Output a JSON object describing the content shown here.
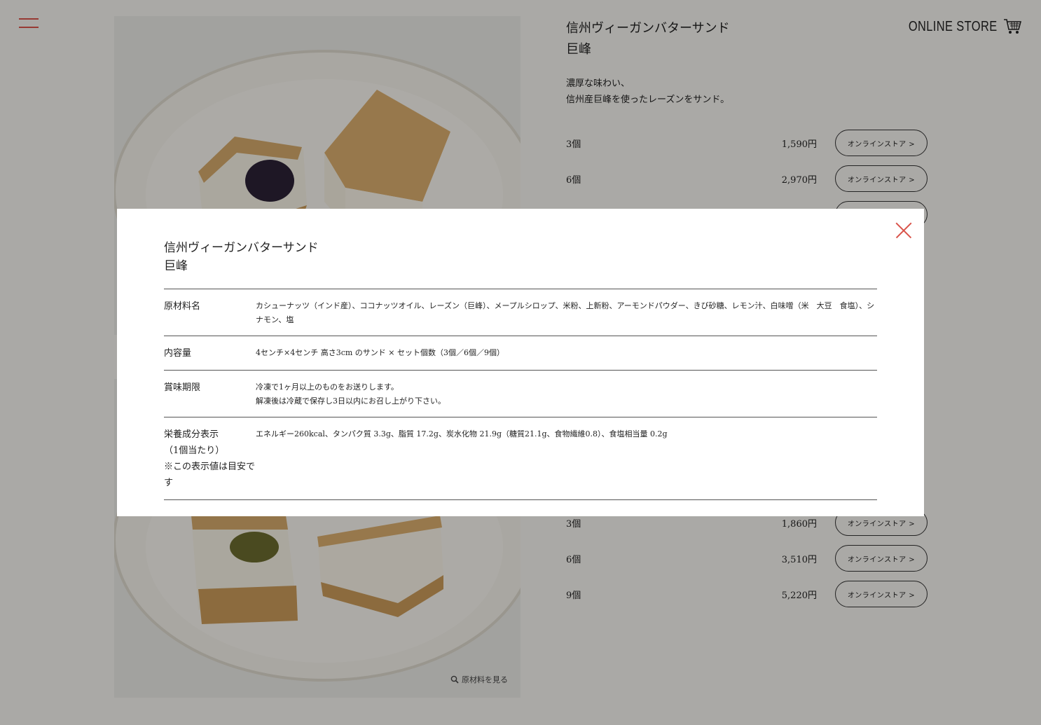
{
  "header": {
    "store_label": "ONLINE STORE"
  },
  "product1": {
    "title_line1": "信州ヴィーガンバターサンド",
    "title_line2": "巨峰",
    "desc_line1": "濃厚な味わい、",
    "desc_line2": "信州産巨峰を使ったレーズンをサンド。",
    "rows": [
      {
        "qty": "3個",
        "price": "1,590円",
        "button": "オンラインストア >"
      },
      {
        "qty": "6個",
        "price": "2,970円",
        "button": "オンラインストア >"
      }
    ]
  },
  "product2": {
    "zoom_label": "原材料を見る",
    "rows": [
      {
        "qty": "3個",
        "price": "1,860円",
        "button": "オンラインストア >"
      },
      {
        "qty": "6個",
        "price": "3,510円",
        "button": "オンラインストア >"
      },
      {
        "qty": "9個",
        "price": "5,220円",
        "button": "オンラインストア >"
      }
    ]
  },
  "modal": {
    "title_line1": "信州ヴィーガンバターサンド",
    "title_line2": "巨峰",
    "rows": [
      {
        "key": [
          "原材料名"
        ],
        "value": [
          "カシューナッツ（インド産）、ココナッツオイル、レーズン（巨峰）、メープルシロップ、米粉、上新粉、アーモンドパウダー、きび砂糖、レモン汁、白味噌（米　大豆　食塩）、シナモン、塩"
        ]
      },
      {
        "key": [
          "内容量"
        ],
        "value": [
          "4センチ×4センチ 高さ3cm のサンド × セット個数（3個／6個／9個）"
        ]
      },
      {
        "key": [
          "賞味期限"
        ],
        "value": [
          "冷凍で1ヶ月以上のものをお送りします。",
          "解凍後は冷蔵で保存し3日以内にお召し上がり下さい。"
        ]
      },
      {
        "key": [
          "栄養成分表示",
          "（1個当たり）",
          "※この表示値は目安です"
        ],
        "value": [
          "エネルギー260kcal、タンパク質 3.3g、脂質 17.2g、炭水化物 21.9g（糖質21.1g、食物繊維0.8）、食塩相当量 0.2g"
        ]
      }
    ]
  },
  "colors": {
    "accent": "#d9534a",
    "background": "#f4f2ee",
    "overlay": "rgba(0,0,0,0.3)"
  }
}
